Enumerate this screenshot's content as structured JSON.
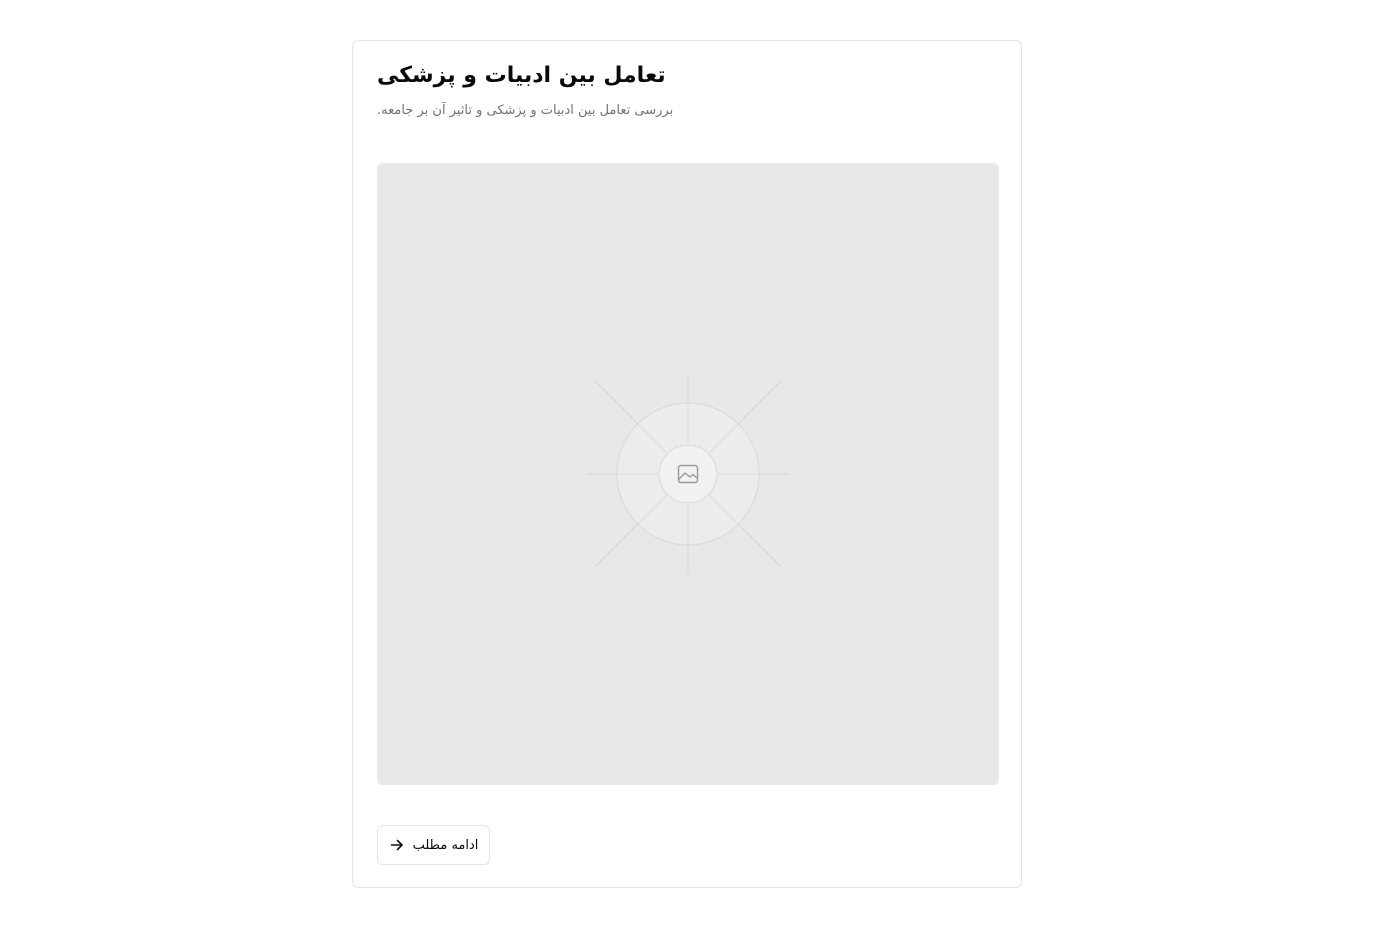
{
  "article": {
    "title": "تعامل بین ادبیات و پزشکی",
    "description": ".بررسی تعامل بین ادبیات و پزشکی و تاثیر آن بر جامعه"
  },
  "media": {
    "icon": "image-icon"
  },
  "actions": {
    "read_more_label": "ادامه مطلب",
    "read_more_icon": "arrow-right-icon"
  }
}
